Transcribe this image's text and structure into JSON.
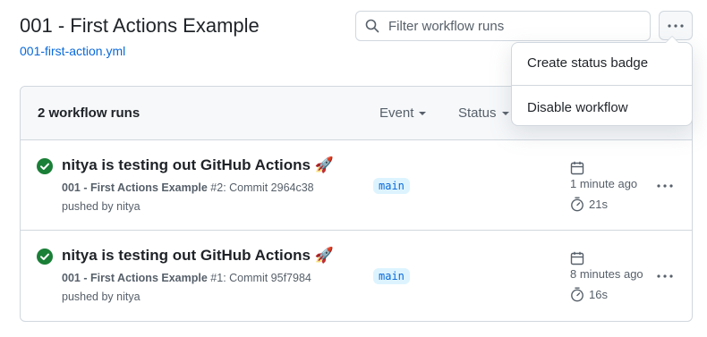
{
  "page": {
    "title": "001 - First Actions Example",
    "workflow_file": "001-first-action.yml"
  },
  "filter": {
    "placeholder": "Filter workflow runs",
    "icon": "search-icon"
  },
  "menu": {
    "items": [
      {
        "label": "Create status badge"
      },
      {
        "label": "Disable workflow"
      }
    ]
  },
  "runs_header": {
    "count_label": "2 workflow runs",
    "event_label": "Event",
    "status_label": "Status"
  },
  "runs": [
    {
      "title": "nitya is testing out GitHub Actions 🚀",
      "workflow": "001 - First Actions Example",
      "run_number": "#2",
      "commit_text": ": Commit 2964c38",
      "pushed_by": "pushed by nitya",
      "branch": "main",
      "time": "1 minute ago",
      "duration": "21s",
      "status": "success"
    },
    {
      "title": "nitya is testing out GitHub Actions 🚀",
      "workflow": "001 - First Actions Example",
      "run_number": "#1",
      "commit_text": ": Commit 95f7984",
      "pushed_by": "pushed by nitya",
      "branch": "main",
      "time": "8 minutes ago",
      "duration": "16s",
      "status": "success"
    }
  ],
  "colors": {
    "link": "#0969da",
    "success": "#1a7f37",
    "muted": "#57606a",
    "border": "#d0d7de",
    "header_bg": "#f6f8fa",
    "branch_bg": "#ddf4ff"
  }
}
